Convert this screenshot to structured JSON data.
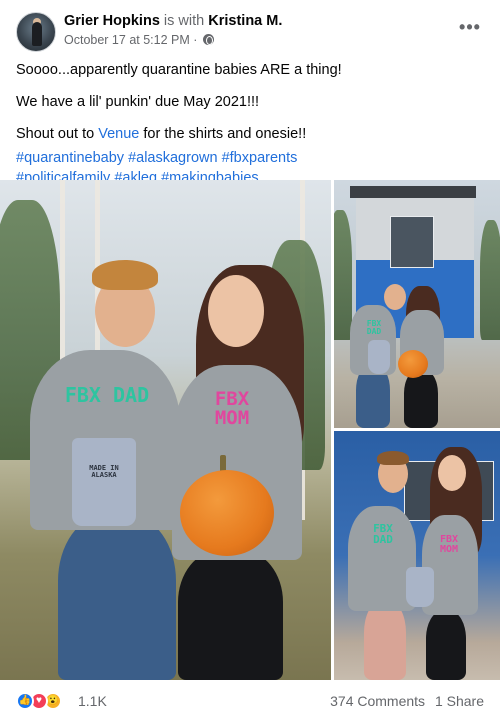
{
  "post": {
    "author": "Grier Hopkins",
    "with_text": "is with",
    "tagged": "Kristina M.",
    "timestamp": "October 17 at 5:12 PM",
    "separator": "·",
    "more_label": "•••",
    "text_line1": "Soooo...apparently quarantine babies ARE a thing!",
    "text_line2": "We have a lil' punkin' due May 2021!!!",
    "shoutout_prefix": "Shout out to ",
    "shoutout_link": "Venue",
    "shoutout_suffix": " for the shirts and onesie!!",
    "hashtags_line1": [
      "#quarantinebaby",
      "#alaskagrown",
      "#fbxparents"
    ],
    "hashtags_line2": [
      "#politicalfamily",
      "#akleg",
      "#makingbabies"
    ]
  },
  "photos": {
    "main": {
      "shirt_man": "FBX DAD",
      "shirt_woman": "FBX MOM",
      "onesie": "MADE IN ALASKA"
    },
    "top": {
      "shirt_man": "FBX DAD"
    },
    "bottom": {
      "shirt_man": "FBX DAD",
      "shirt_woman": "FBX MOM"
    }
  },
  "reactions": {
    "icons": [
      "like-icon",
      "love-icon",
      "wow-icon"
    ],
    "like_glyph": "👍",
    "love_glyph": "♥",
    "wow_glyph": "😮",
    "count": "1.1K",
    "comments": "374 Comments",
    "shares": "1 Share"
  },
  "colors": {
    "link": "#216fdb",
    "muted": "#65676b",
    "like": "#1877f2",
    "love": "#f33e58",
    "wow": "#f7b125"
  }
}
